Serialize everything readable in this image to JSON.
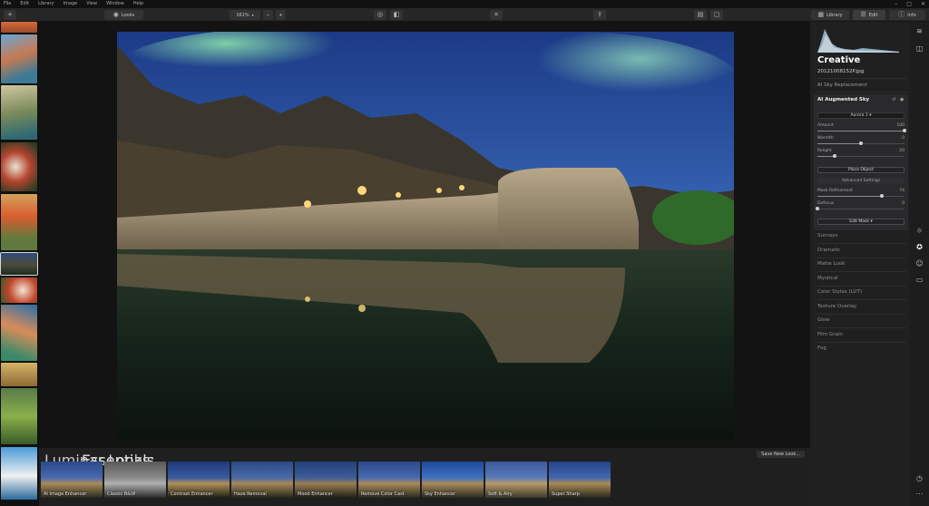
{
  "menu": [
    "File",
    "Edit",
    "Library",
    "Image",
    "View",
    "Window",
    "Help"
  ],
  "window_controls": [
    "–",
    "□",
    "✕"
  ],
  "toolbar": {
    "looks_label": "Looks",
    "zoom": "161%",
    "zoom_minus": "−",
    "zoom_plus": "+",
    "library_label": "Library",
    "edit_label": "Edit",
    "info_label": "Info"
  },
  "looks": {
    "title": "Luminar Looks:",
    "category": "Essentials",
    "save_label": "Save New Look...",
    "items": [
      {
        "label": "AI Image Enhancer"
      },
      {
        "label": "Classic B&W"
      },
      {
        "label": "Contrast Enhancer"
      },
      {
        "label": "Haze Removal"
      },
      {
        "label": "Mood Enhancer"
      },
      {
        "label": "Remove Color Cast"
      },
      {
        "label": "Sky Enhancer"
      },
      {
        "label": "Soft & Airy"
      },
      {
        "label": "Super Sharp"
      }
    ]
  },
  "panel": {
    "title": "Creative",
    "filename": "20121008152P.jpg",
    "section": "AI Sky Replacement",
    "tool": {
      "name": "AI Augmented Sky",
      "preset": "Aurora 1",
      "sliders": [
        {
          "label": "Amount",
          "value": "100",
          "fraction": 1.0
        },
        {
          "label": "Warmth",
          "value": "0",
          "fraction": 0.5
        },
        {
          "label": "Relight",
          "value": "20",
          "fraction": 0.2
        }
      ],
      "place_object": "Place Object",
      "advanced": "Advanced Settings",
      "sliders2": [
        {
          "label": "Mask Refinement",
          "value": "74",
          "fraction": 0.74
        },
        {
          "label": "Defocus",
          "value": "0",
          "fraction": 0.0
        }
      ],
      "edit_mask": "Edit Mask"
    },
    "items": [
      "Sunrays",
      "Dramatic",
      "Matte Look",
      "Mystical",
      "Color Styles (LUT)",
      "Texture Overlay",
      "Glow",
      "Film Grain",
      "Fog"
    ]
  },
  "colors": {
    "accent": "#ffffff",
    "panel": "#202021",
    "canvas": "#131314"
  }
}
